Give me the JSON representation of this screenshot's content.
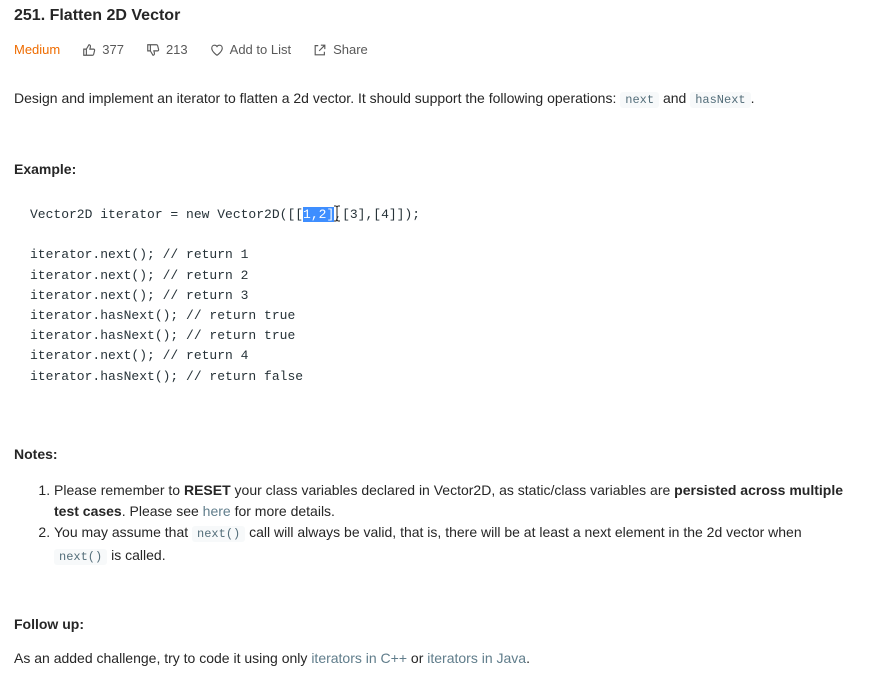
{
  "problem": {
    "title": "251. Flatten 2D Vector",
    "difficulty": "Medium",
    "likes": "377",
    "dislikes": "213",
    "add_to_list": "Add to List",
    "share": "Share"
  },
  "description": {
    "text_before": "Design and implement an iterator to flatten a 2d vector. It should support the following operations: ",
    "code1": "next",
    "text_mid": " and ",
    "code2": "hasNext",
    "text_after": "."
  },
  "example": {
    "label": "Example:",
    "line1_before": "Vector2D iterator = new Vector2D([[",
    "line1_selected": "1,2]",
    "line1_after": ",[3],[4]]);",
    "lines": [
      "iterator.next(); // return 1",
      "iterator.next(); // return 2",
      "iterator.next(); // return 3",
      "iterator.hasNext(); // return true",
      "iterator.hasNext(); // return true",
      "iterator.next(); // return 4",
      "iterator.hasNext(); // return false"
    ]
  },
  "notes": {
    "label": "Notes:",
    "n1_a": "Please remember to ",
    "n1_bold1": "RESET",
    "n1_b": " your class variables declared in Vector2D, as static/class variables are ",
    "n1_bold2": "persisted across multiple test cases",
    "n1_c": ". Please see ",
    "n1_link": "here",
    "n1_d": " for more details.",
    "n2_a": "You may assume that ",
    "n2_code1": "next()",
    "n2_b": " call will always be valid, that is, there will be at least a next element in the 2d vector when ",
    "n2_code2": "next()",
    "n2_c": " is called."
  },
  "follow_up": {
    "label": "Follow up:",
    "text_a": "As an added challenge, try to code it using only ",
    "link1": "iterators in C++",
    "text_b": " or ",
    "link2": "iterators in Java",
    "text_c": "."
  }
}
